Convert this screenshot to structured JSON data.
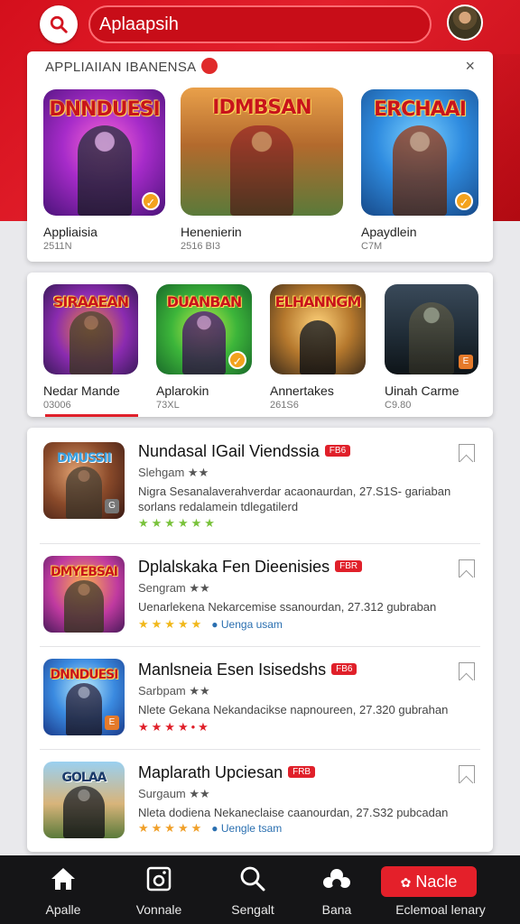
{
  "header": {
    "search_text": "Aplaapsih"
  },
  "featured": {
    "title": "APPLIAIIAN IBANENSA",
    "close_glyph": "×",
    "items": [
      {
        "art_label": "DNNDUESI",
        "name": "Appliaisia",
        "sub": "2511N"
      },
      {
        "art_label": "IDMBSAN",
        "name": "Henenierin",
        "sub": "2516 BI3"
      },
      {
        "art_label": "ERCHAAI",
        "name": "Apaydlein",
        "sub": "C7M"
      }
    ]
  },
  "second_row": {
    "items": [
      {
        "art_label": "SIRAAEAN",
        "name": "Nedar Mande",
        "sub": "03006"
      },
      {
        "art_label": "DUANBAN",
        "name": "Aplarokin",
        "sub": "73XL"
      },
      {
        "art_label": "ELHANNGM",
        "name": "Annertakes",
        "sub": "261S6"
      },
      {
        "art_label": "",
        "name": "Uinah Carme",
        "sub": "C9.80"
      }
    ]
  },
  "list": {
    "rows": [
      {
        "art_label": "DMUSSII",
        "title": "Nundasal IGail Viendssia",
        "tag": "FB6",
        "sub": "Slehgam ★★",
        "desc": "Nigra Sesanalaverahverdar acaonaurdan, 27.S1S- gariaban sorlans redalamein tdlegatilerd",
        "stars": "★★★★★★",
        "link": ""
      },
      {
        "art_label": "DMYEBSAI",
        "title": "Dplalskaka Fen Dieenisies",
        "tag": "FBR",
        "sub": "Sengram ★★",
        "desc": "Uenarlekena Nekarcemise ssanourdan, 27.312 gubraban",
        "stars": "★★★★★",
        "link": "Uenga usam"
      },
      {
        "art_label": "DNNDUESI",
        "title": "Manlsneia Esen Isisedshs",
        "tag": "FB6",
        "sub": "Sarbpam ★★",
        "desc": "Nlete Gekana Nekandacikse napnoureen, 27.320 gubrahan",
        "stars": "★★★★•★",
        "link": ""
      },
      {
        "art_label": "GOLAA",
        "title": "Maplarath Upciesan",
        "tag": "FRB",
        "sub": "Surgaum ★★",
        "desc": "Nleta dodiena Nekaneclaise caanourdan, 27.S32 pubcadan",
        "stars": "★★★★★",
        "link": "Uengle tsam"
      }
    ]
  },
  "bottom_nav": {
    "items": [
      {
        "label": "Apalle",
        "icon": "home-icon"
      },
      {
        "label": "Vonnale",
        "icon": "camera-icon"
      },
      {
        "label": "Sengalt",
        "icon": "search-icon"
      },
      {
        "label": "Bana",
        "icon": "game-icon"
      }
    ],
    "cta_label": "Nacle",
    "cta_caption": "Eclemoal lenary"
  },
  "colors": {
    "brand_red": "#e0202a",
    "nav_bg": "#151517",
    "link_blue": "#2a6fb0",
    "star_yellow": "#f1b81b"
  }
}
